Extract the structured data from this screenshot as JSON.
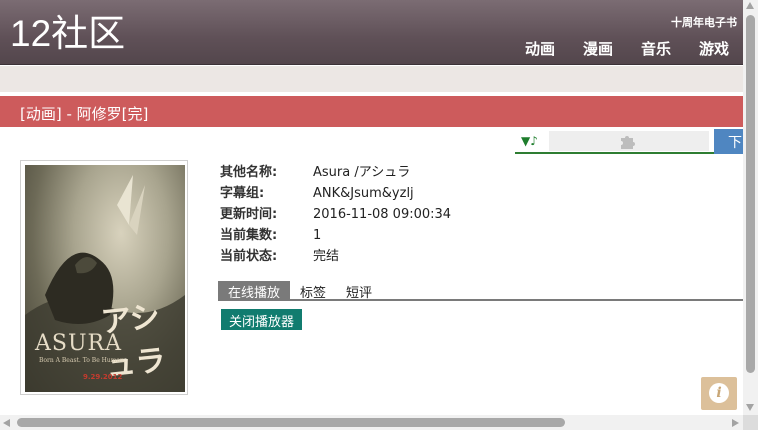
{
  "header": {
    "logo": "12社区",
    "ebook_link": "十周年电子书",
    "nav": [
      "动画",
      "漫画",
      "音乐",
      "游戏"
    ]
  },
  "title_bar": {
    "text": "[动画] - 阿修罗[完]"
  },
  "toolbar": {
    "music_icon": "▼♪",
    "plugin_icon": "puzzle-icon",
    "download_label": "下"
  },
  "poster": {
    "title": "ASURA",
    "tagline": "Born A Beast. To Be Human.",
    "japanese_title": "アシュラ",
    "date_text": "9.29.2012"
  },
  "info": {
    "rows": [
      {
        "label": "其他名称:",
        "value": "Asura /アシュラ"
      },
      {
        "label": "字幕组:",
        "value": "ANK&Jsum&yzlj"
      },
      {
        "label": "更新时间:",
        "value": "2016-11-08 09:00:34"
      },
      {
        "label": "当前集数:",
        "value": "1"
      },
      {
        "label": "当前状态:",
        "value": "完结"
      }
    ]
  },
  "tabs": [
    "在线播放",
    "标签",
    "短评"
  ],
  "active_tab": "在线播放",
  "close_player_label": "关闭播放器",
  "info_button": "i",
  "colors": {
    "header": "#5f5057",
    "title_bar": "#cd5b5c",
    "download": "#4f86c1",
    "close_player": "#117c6f",
    "info_button": "#dcc09a"
  }
}
